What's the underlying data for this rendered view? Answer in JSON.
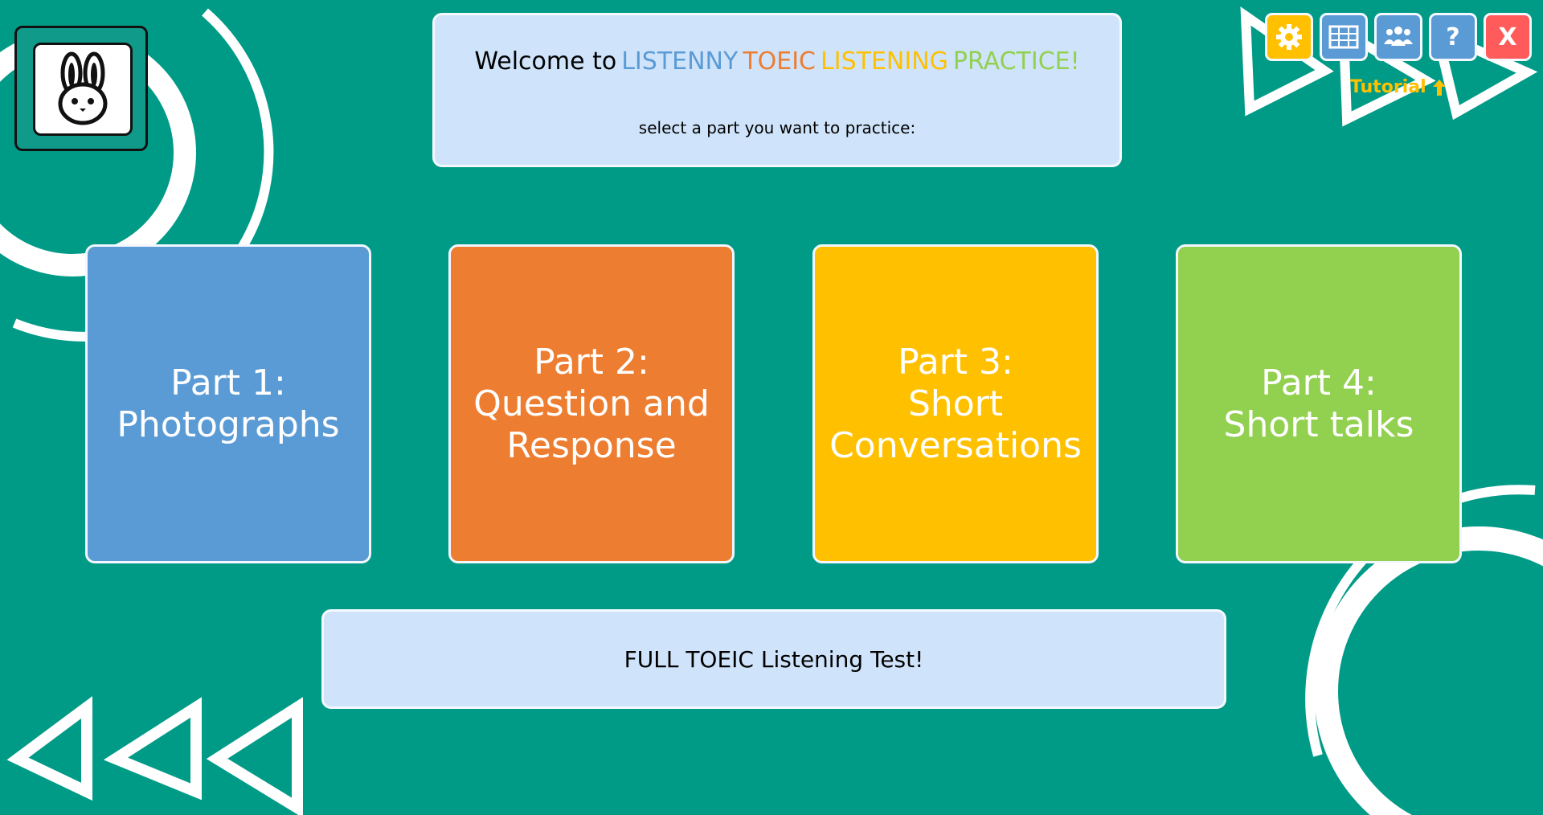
{
  "header": {
    "welcome_prefix": "Welcome to",
    "title_words": [
      "LISTENNY",
      "TOEIC",
      "LISTENING",
      "PRACTICE!"
    ],
    "subtitle": "select a part you want to practice:"
  },
  "parts": [
    {
      "line1": "Part 1:",
      "line2": "Photographs",
      "line3": "",
      "color": "#5b9bd5"
    },
    {
      "line1": "Part 2:",
      "line2": "Question and",
      "line3": "Response",
      "color": "#ed7d31"
    },
    {
      "line1": "Part 3:",
      "line2": "Short",
      "line3": "Conversations",
      "color": "#ffc000"
    },
    {
      "line1": "Part 4:",
      "line2": "Short talks",
      "line3": "",
      "color": "#92d050"
    }
  ],
  "full_test": {
    "label": "FULL TOEIC Listening Test!"
  },
  "toolbar": {
    "buttons": [
      {
        "icon": "gear-icon",
        "color": "#ffc000"
      },
      {
        "icon": "table-icon",
        "color": "#5b9bd5"
      },
      {
        "icon": "group-icon",
        "color": "#5b9bd5"
      },
      {
        "icon": "help-icon",
        "label": "?",
        "color": "#5b9bd5"
      },
      {
        "icon": "close-icon",
        "label": "X",
        "color": "#ff5b5b"
      }
    ],
    "tutorial_label": "Tutorial"
  },
  "theme": {
    "background": "#009b87",
    "panel": "#cfe4fa"
  }
}
